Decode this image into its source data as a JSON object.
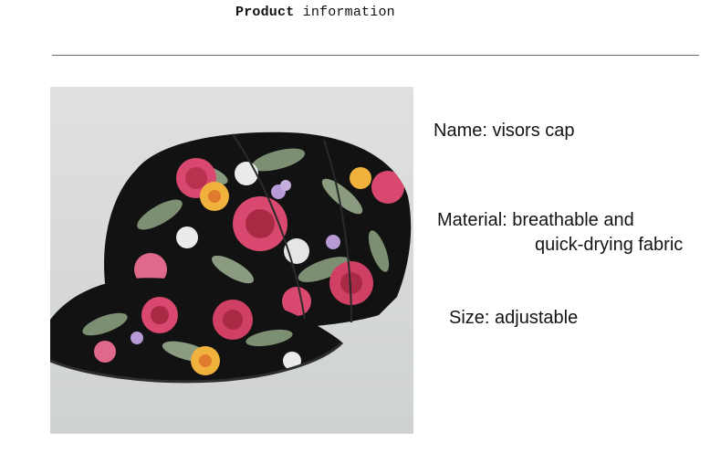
{
  "header": {
    "title_bold": "Product",
    "title_rest": "information"
  },
  "product_image": {
    "description_icon": "floral-baseball-cap-image"
  },
  "specs": {
    "name": "Name: visors cap",
    "material_line1": "Material:  breathable and",
    "material_line2": "quick-drying fabric",
    "size": "Size: adjustable"
  },
  "colors": {
    "divider": "#6e6e6e",
    "cap_base": "#121212",
    "rose": "#d9486e",
    "leaf": "#7d8f73",
    "yellow": "#f0b23c",
    "lilac": "#b79ad6"
  }
}
